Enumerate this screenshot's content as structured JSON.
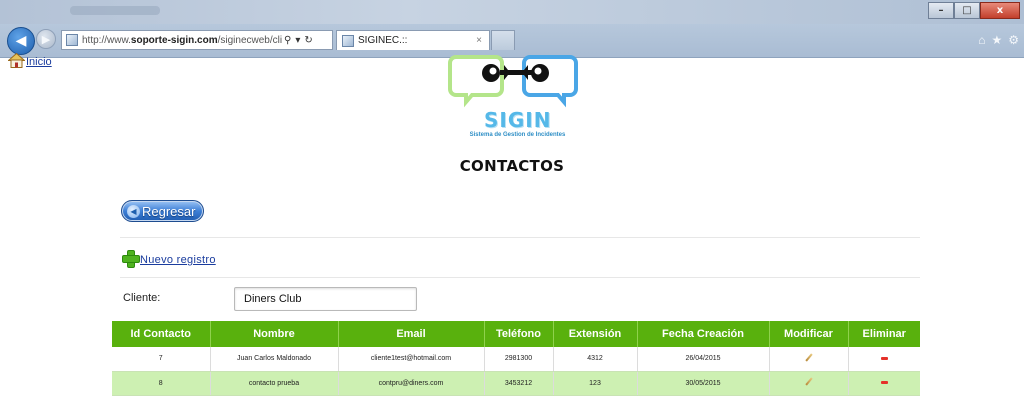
{
  "browser": {
    "url_prefix": "http://www.",
    "url_domain": "soporte-sigin.com",
    "url_path": "/siginecweb/cliente/ed",
    "search_glyph": "⚲",
    "dropdown_glyph": "▾",
    "refresh_glyph": "↻",
    "tab_title": "SIGINEC.::",
    "tab_close": "×",
    "window_buttons": [
      "–",
      "□",
      "x"
    ],
    "toolbar_icons": [
      "⌂",
      "★",
      "⚙"
    ]
  },
  "nav": {
    "home_label": "Inicio"
  },
  "logo": {
    "word": "SIGIN",
    "subtitle": "Sistema de Gestion de Incidentes"
  },
  "page": {
    "title": "CONTACTOS",
    "back_button_label": "Regresar",
    "new_record_label": "Nuevo registro",
    "client_label": "Cliente:",
    "client_value": "Diners Club"
  },
  "table": {
    "headers": [
      "Id Contacto",
      "Nombre",
      "Email",
      "Teléfono",
      "Extensión",
      "Fecha Creación",
      "Modificar",
      "Eliminar"
    ],
    "rows": [
      {
        "id": "7",
        "nombre": "Juan Carlos Maldonado",
        "email": "cliente1test@hotmail.com",
        "telefono": "2981300",
        "extension": "4312",
        "fecha": "26/04/2015"
      },
      {
        "id": "8",
        "nombre": "contacto prueba",
        "email": "contpru@diners.com",
        "telefono": "3453212",
        "extension": "123",
        "fecha": "30/05/2015"
      }
    ]
  },
  "colors": {
    "header_green": "#59b10d",
    "alt_row_green": "#cdf0b2",
    "link_blue": "#1a3c9e",
    "logo_blue": "#55b8e8"
  }
}
